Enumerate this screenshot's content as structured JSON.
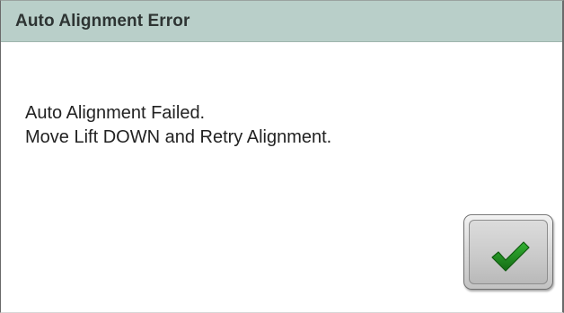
{
  "dialog": {
    "title": "Auto Alignment Error",
    "message_lines": [
      "Auto Alignment Failed.",
      "Move Lift DOWN and Retry Alignment."
    ],
    "ok_button": {
      "icon": "checkmark-icon",
      "icon_color": "#1f8a1f"
    }
  },
  "colors": {
    "title_bar": "#b9cfc9",
    "background": "#ffffff",
    "button_face": "#d0d0d0"
  }
}
